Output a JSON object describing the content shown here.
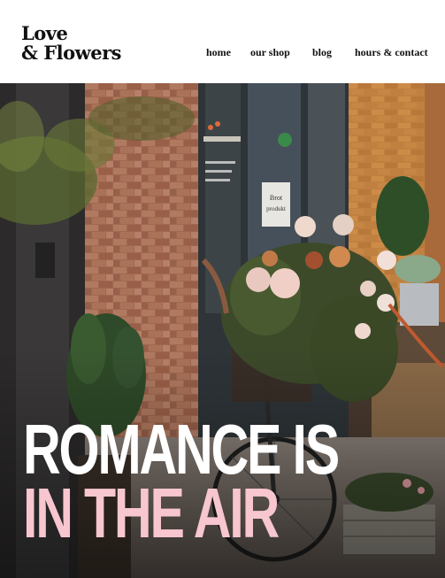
{
  "brand": {
    "line1": "Love",
    "line2": "& Flowers"
  },
  "nav": {
    "home": "home",
    "shop": "our shop",
    "blog": "blog",
    "hours": "hours & contact"
  },
  "hero": {
    "headline_line1": "ROMANCE IS",
    "headline_line2": "IN THE AIR",
    "line1_color": "#ffffff",
    "line2_color": "#f7c6cf"
  },
  "photo_signs": {
    "door_sign": "Brot produkt"
  },
  "icons": [
    "flower-bicycle-photo"
  ]
}
